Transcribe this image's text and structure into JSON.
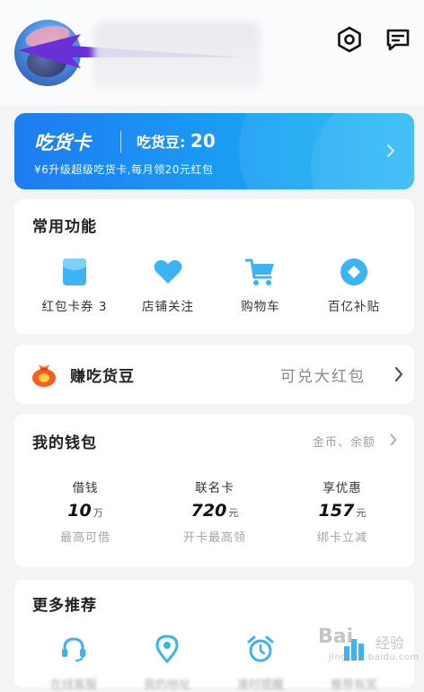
{
  "header": {
    "settings_icon": "settings-hexagon-icon",
    "message_icon": "message-icon"
  },
  "vip_card": {
    "title": "吃货卡",
    "beans_label": "吃货豆:",
    "beans_value": "20",
    "subtitle": "¥6升级超级吃货卡,每月领20元红包"
  },
  "common_functions": {
    "title": "常用功能",
    "items": [
      {
        "label": "红包卡券 3",
        "icon": "red-packet-icon"
      },
      {
        "label": "店铺关注",
        "icon": "heart-icon"
      },
      {
        "label": "购物车",
        "icon": "cart-icon"
      },
      {
        "label": "百亿补贴",
        "icon": "subsidy-icon"
      }
    ]
  },
  "earn_beans": {
    "title": "赚吃货豆",
    "right_text": "可兑大红包"
  },
  "wallet": {
    "title": "我的钱包",
    "more": "金币、余额",
    "items": [
      {
        "label": "借钱",
        "value": "10",
        "unit": "万",
        "desc": "最高可借"
      },
      {
        "label": "联名卡",
        "value": "720",
        "unit": "元",
        "desc": "开卡最高领"
      },
      {
        "label": "享优惠",
        "value": "157",
        "unit": "元",
        "desc": "绑卡立减"
      }
    ]
  },
  "recommend": {
    "title": "更多推荐",
    "items": [
      {
        "label": "在线客服",
        "icon": "headset-icon"
      },
      {
        "label": "我的地址",
        "icon": "location-icon"
      },
      {
        "label": "准时提醒",
        "icon": "alarm-icon"
      },
      {
        "label": "推荐有奖",
        "icon": "building-icon"
      }
    ]
  },
  "watermark": {
    "main": "Bai",
    "side": "经验",
    "url": "jingyan.baidu.com"
  },
  "colors": {
    "accent": "#1d8ff2",
    "icon_blue": "#3ab4f2",
    "background": "#f3f4f6",
    "arrow": "#6a2fd6"
  }
}
